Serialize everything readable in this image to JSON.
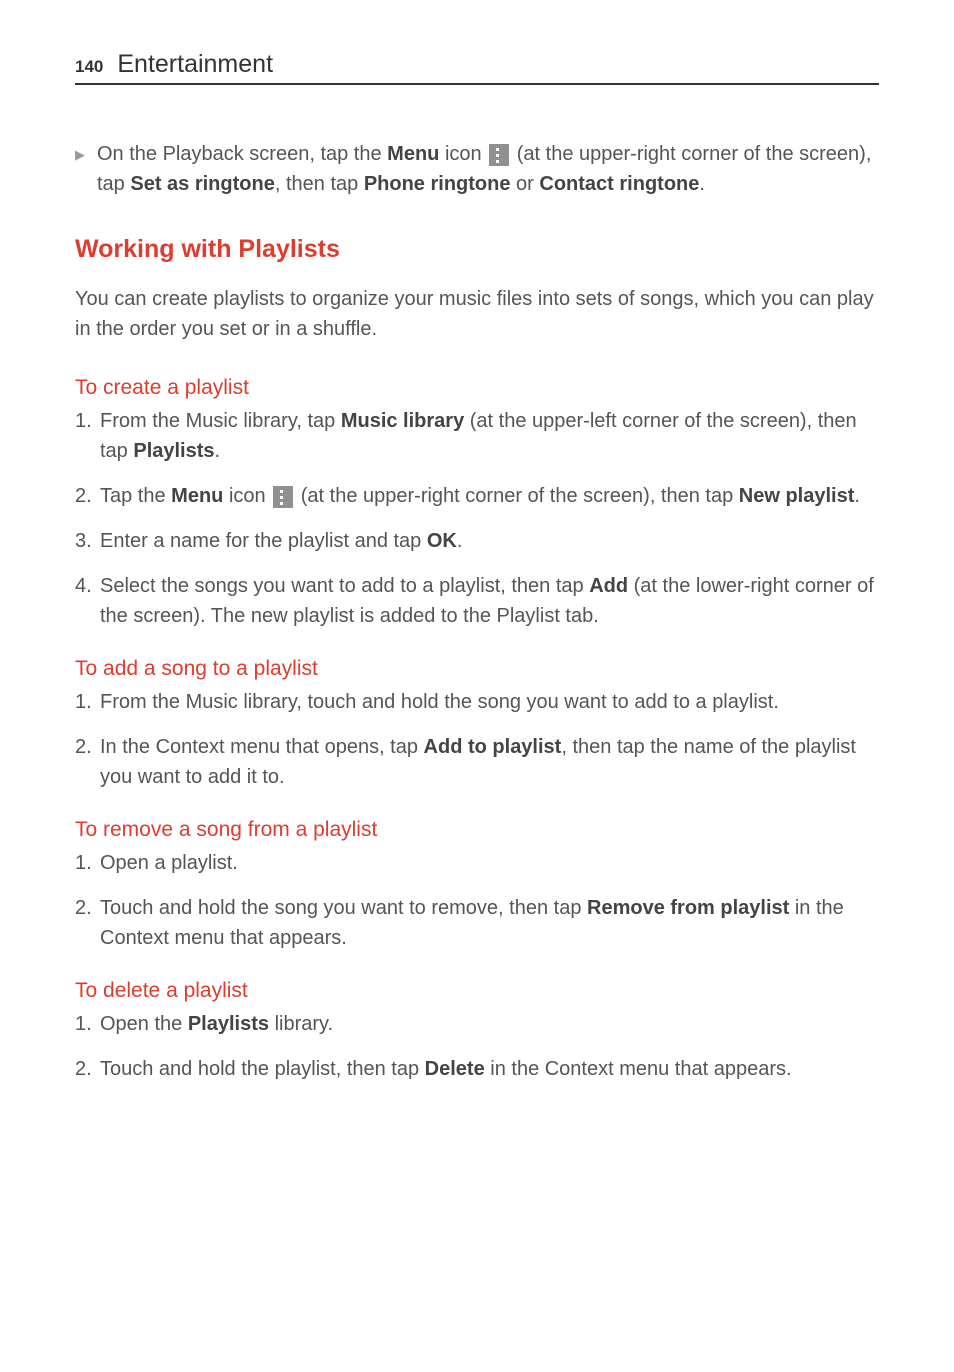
{
  "header": {
    "pageNumber": "140",
    "title": "Entertainment"
  },
  "bullet1": {
    "pre": "On the Playback screen, tap the ",
    "b1": "Menu",
    "mid1": " icon ",
    "mid2": " (at the upper-right corner of the screen), tap ",
    "b2": "Set as ringtone",
    "mid3": ", then tap ",
    "b3": "Phone ringtone",
    "mid4": " or ",
    "b4": "Contact ringtone",
    "end": "."
  },
  "h1": "Working with Playlists",
  "p1": "You can create playlists to organize your music files into sets of songs, which you can play in the order you set or in a shuffle.",
  "h2": "To create a playlist",
  "create": {
    "s1a": "From the Music library, tap ",
    "s1b": "Music library",
    "s1c": " (at the upper-left corner of the screen), then tap ",
    "s1d": "Playlists",
    "s1e": ".",
    "s2a": "Tap the ",
    "s2b": "Menu",
    "s2c": " icon ",
    "s2d": " (at the upper-right corner of the screen), then tap ",
    "s2e": "New playlist",
    "s2f": ".",
    "s3a": "Enter a name for the playlist and tap ",
    "s3b": "OK",
    "s3c": ".",
    "s4a": "Select the songs you want to add to a playlist, then tap ",
    "s4b": "Add",
    "s4c": " (at the lower-right corner of the screen). The new playlist is added to the Playlist tab."
  },
  "h3": "To add a song to a playlist",
  "add": {
    "s1": "From the Music library, touch and hold the song you want to add to a playlist.",
    "s2a": "In the Context menu that opens, tap ",
    "s2b": "Add to playlist",
    "s2c": ", then tap the name of the playlist you want to add it to."
  },
  "h4": "To remove a song from a playlist",
  "remove": {
    "s1": "Open a playlist.",
    "s2a": "Touch and hold the song you want to remove, then tap ",
    "s2b": "Remove from playlist",
    "s2c": " in the Context menu that appears."
  },
  "h5": "To delete a playlist",
  "delete": {
    "s1a": "Open the ",
    "s1b": "Playlists",
    "s1c": " library.",
    "s2a": "Touch and hold the playlist, then tap ",
    "s2b": "Delete",
    "s2c": " in the Context menu that appears."
  },
  "nums": {
    "n1": "1.",
    "n2": "2.",
    "n3": "3.",
    "n4": "4."
  }
}
